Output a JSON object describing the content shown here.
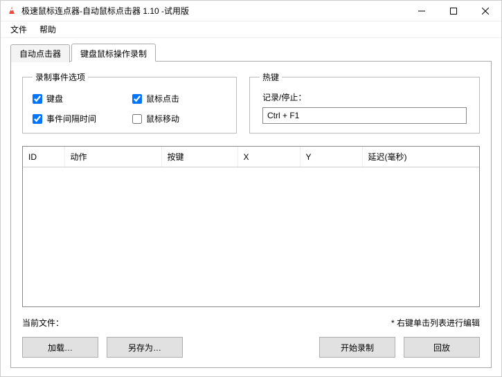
{
  "window": {
    "title": "极速鼠标连点器-自动鼠标点击器 1.10  -试用版"
  },
  "menu": {
    "file": "文件",
    "help": "帮助"
  },
  "tabs": {
    "auto_clicker": "自动点击器",
    "kbm_recorder": "键盘鼠标操作录制"
  },
  "record_options": {
    "legend": "录制事件选项",
    "keyboard": "键盘",
    "mouse_click": "鼠标点击",
    "event_interval": "事件间隔时间",
    "mouse_move": "鼠标移动",
    "checked": {
      "keyboard": true,
      "mouse_click": true,
      "event_interval": true,
      "mouse_move": false
    }
  },
  "hotkey": {
    "legend": "热键",
    "label": "记录/停止：",
    "value": "Ctrl + F1"
  },
  "table": {
    "cols": {
      "id": "ID",
      "action": "动作",
      "key": "按键",
      "x": "X",
      "y": "Y",
      "delay": "延迟(毫秒)"
    }
  },
  "footer": {
    "current_file_label": "当前文件：",
    "current_file_value": "",
    "hint": "* 右键单击列表进行编辑"
  },
  "buttons": {
    "load": "加载…",
    "save_as": "另存为…",
    "start_record": "开始录制",
    "playback": "回放"
  }
}
